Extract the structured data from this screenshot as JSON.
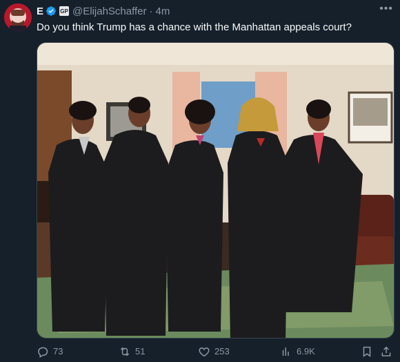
{
  "author": {
    "display_name": "E",
    "handle": "@ElijahSchaffer",
    "separator": "·",
    "time": "4m",
    "affiliate_badge": "GP"
  },
  "tweet": {
    "text": "Do you think Trump has a chance with the Manhattan appeals court?"
  },
  "actions": {
    "replies": "73",
    "retweets": "51",
    "likes": "253",
    "views": "6.9K"
  },
  "icons": {
    "verified": "verified-badge-icon",
    "more": "more-icon",
    "reply": "reply-icon",
    "retweet": "retweet-icon",
    "like": "heart-icon",
    "views": "views-icon",
    "bookmark": "bookmark-icon",
    "share": "share-icon"
  },
  "colors": {
    "background": "#15202b",
    "text": "#f7f9f9",
    "secondary_text": "#8b98a5",
    "verified_blue": "#1d9bf0",
    "border": "#38444d"
  }
}
